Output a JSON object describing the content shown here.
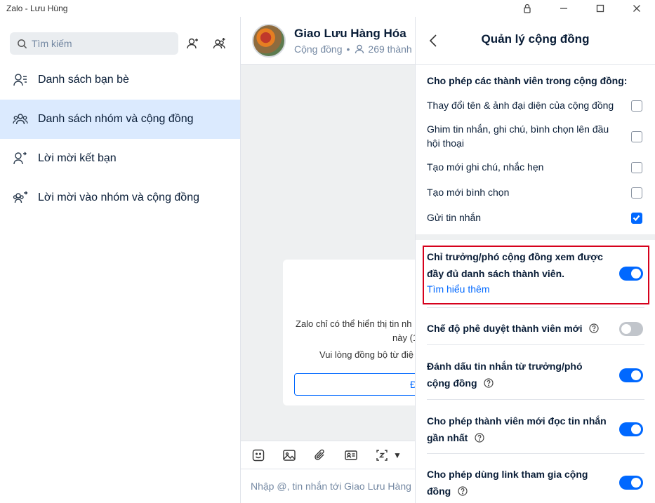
{
  "window": {
    "title": "Zalo - Lưu Hùng"
  },
  "sidebar": {
    "search_placeholder": "Tìm kiếm",
    "items": [
      {
        "label": "Danh sách bạn bè"
      },
      {
        "label": "Danh sách nhóm và cộng đồng",
        "active": true
      },
      {
        "label": "Lời mời kết bạn"
      },
      {
        "label": "Lời mời vào nhóm và cộng đồng"
      }
    ]
  },
  "chat": {
    "title": "Giao Lưu Hàng Hóa",
    "type_label": "Cộng đồng",
    "members_label": "269 thành",
    "notice_line1": "Zalo chỉ có thể hiển thị tin nh",
    "notice_line1b": "này (1",
    "notice_line2": "Vui lòng đồng bộ từ điệ",
    "notice_button": "Đ",
    "input_placeholder": "Nhập @, tin nhắn tới Giao Lưu Hàng"
  },
  "panel": {
    "title": "Quản lý cộng đồng",
    "permissions_heading": "Cho phép các thành viên trong cộng đồng:",
    "permissions": [
      {
        "label": "Thay đổi tên & ảnh đại diện của cộng đồng",
        "checked": false
      },
      {
        "label": "Ghim tin nhắn, ghi chú, bình chọn lên đầu hội thoại",
        "line1": "Ghim tin nhắn, ghi chú, bình chọn lên đầu",
        "line2": "hội thoại",
        "checked": false
      },
      {
        "label": "Tạo mới ghi chú, nhắc hẹn",
        "checked": false
      },
      {
        "label": "Tạo mới bình chọn",
        "checked": false
      },
      {
        "label": "Gửi tin nhắn",
        "checked": true
      }
    ],
    "options": [
      {
        "line1": "Chỉ trưởng/phó cộng đồng xem được",
        "line2": "đầy đủ danh sách thành viên.",
        "link": "Tìm hiểu thêm",
        "on": true
      },
      {
        "line1": "Chế độ phê duyệt thành viên mới",
        "on": false
      },
      {
        "line1": "Đánh dấu tin nhắn từ trưởng/phó",
        "line2": "cộng đồng",
        "on": true
      },
      {
        "line1": "Cho phép thành viên mới đọc tin nhắn",
        "line2": "gần nhất",
        "on": true
      },
      {
        "line1": "Cho phép dùng link tham gia cộng",
        "line2": "đồng",
        "on": true
      }
    ]
  },
  "colors": {
    "accent": "#0068ff",
    "active_nav_bg": "#dbeafe",
    "highlight_border": "#d6001c",
    "toggle_off": "#c1c5cb"
  }
}
